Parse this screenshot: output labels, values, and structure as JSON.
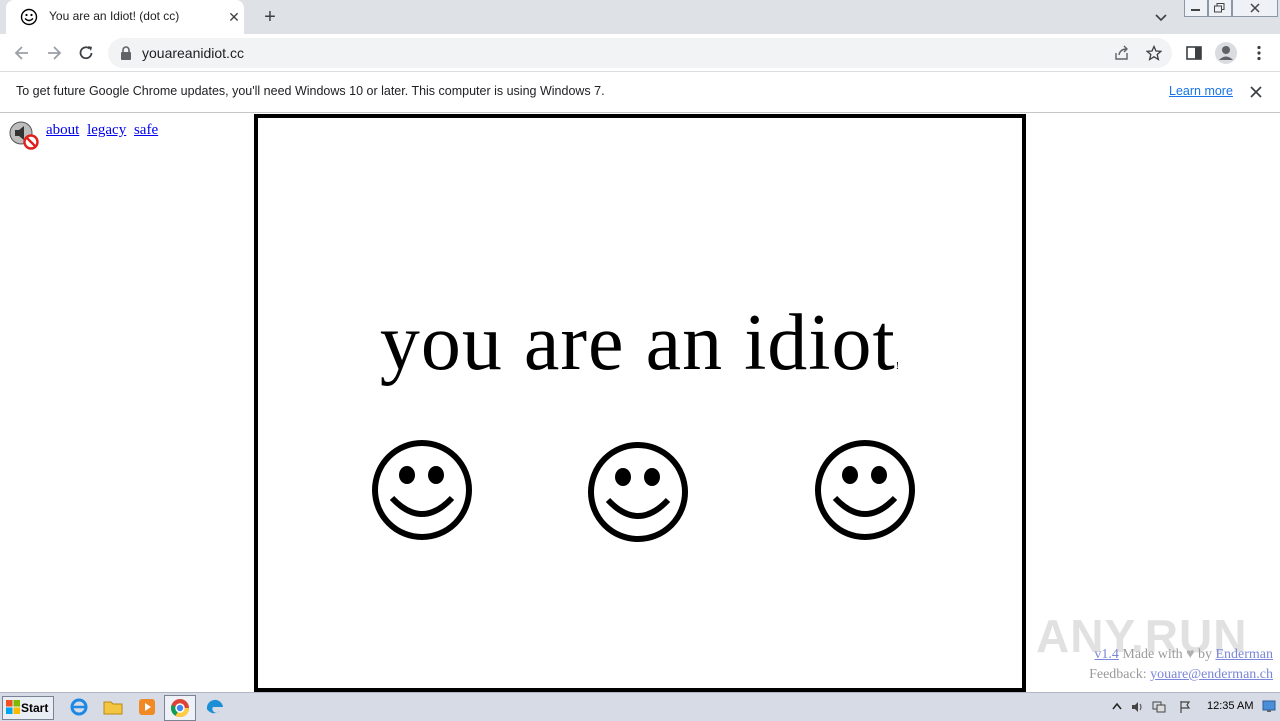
{
  "browser": {
    "tab_title": "You are an Idiot! (dot cc)",
    "new_tab_symbol": "+",
    "url": "youareanidiot.cc"
  },
  "infobar": {
    "message": "To get future Google Chrome updates, you'll need Windows 10 or later. This computer is using Windows 7.",
    "link_label": "Learn more"
  },
  "page": {
    "links": [
      "about",
      "legacy",
      "safe"
    ],
    "headline": "you are an idiot",
    "headline_mark": "!",
    "footer": {
      "version": "v1.4",
      "made_with": " Made with ",
      "by": " by ",
      "author": "Enderman",
      "feedback_label": "Feedback: ",
      "email": "youare@enderman.ch"
    }
  },
  "watermark": "ANY.RUN",
  "taskbar": {
    "start_label": "Start",
    "clock": "12:35 AM"
  },
  "colors": {
    "link": "#0000ee",
    "chrome_link": "#1a73e8",
    "tabstrip": "#dee1e6"
  },
  "icons": [
    "smiley-favicon",
    "close-icon",
    "back-icon",
    "forward-icon",
    "reload-icon",
    "lock-icon",
    "share-icon",
    "star-icon",
    "sidepanel-icon",
    "profile-icon",
    "menu-icon",
    "speaker-muted-icon",
    "smiley-icon"
  ]
}
